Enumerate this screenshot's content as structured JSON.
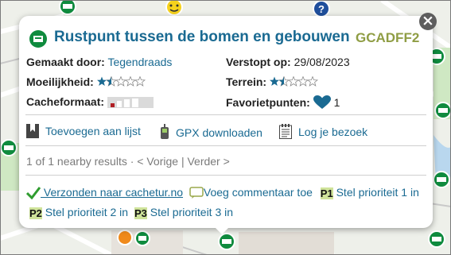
{
  "popup": {
    "title": "Rustpunt tussen de bomen en gebouwen",
    "gc_code": "GCADFF2",
    "placed_by_label": "Gemaakt door:",
    "placed_by_value": "Tegendraads",
    "hidden_label": "Verstopt op:",
    "hidden_value": "29/08/2023",
    "difficulty_label": "Moeilijkheid:",
    "difficulty_value": 1.5,
    "terrain_label": "Terrein:",
    "terrain_value": 1.5,
    "size_label": "Cacheformaat:",
    "size_level": "small",
    "favorites_label": "Favorietpunten:",
    "favorites_value": "1",
    "actions": {
      "add_to_list": "Toevoegen aan lijst",
      "gpx": "GPX downloaden",
      "log": "Log je bezoek"
    },
    "nearby": "1 of 1 nearby results · < Vorige | Verder >",
    "extension": {
      "sent": " Verzonden naar cachetur.no",
      "comment": "Voeg commentaar toe",
      "p1_badge": "P1",
      "p1_text": "Stel prioriteit 1 in",
      "p2_badge": "P2",
      "p2_text": "Stel prioriteit 2 in",
      "p3_badge": "P3",
      "p3_text": "Stel prioriteit 3 in"
    }
  },
  "colors": {
    "link": "#1a6a92",
    "gc_code": "#8f9d44",
    "cache_green": "#0f8b3e",
    "star": "#1a6a92"
  }
}
